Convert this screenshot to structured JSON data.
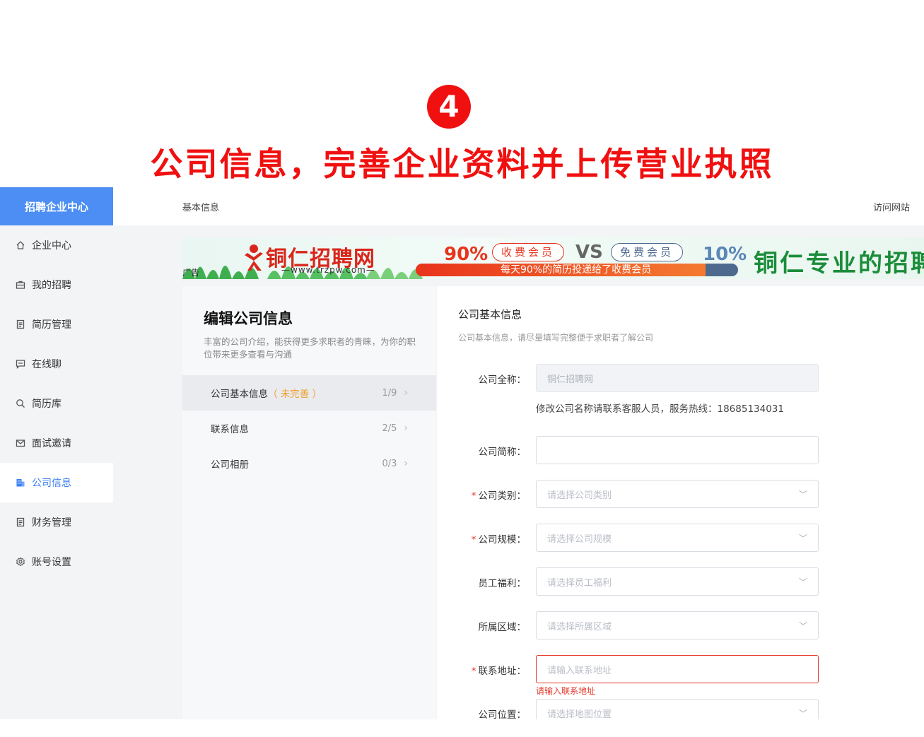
{
  "banner": {
    "step_number": "4",
    "headline": "公司信息，完善企业资料并上传营业执照"
  },
  "sidebar": {
    "brand": "招聘企业中心",
    "items": [
      {
        "label": "企业中心",
        "icon": "home-icon"
      },
      {
        "label": "我的招聘",
        "icon": "briefcase-icon"
      },
      {
        "label": "简历管理",
        "icon": "document-icon"
      },
      {
        "label": "在线聊",
        "icon": "chat-icon"
      },
      {
        "label": "简历库",
        "icon": "search-icon"
      },
      {
        "label": "面试邀请",
        "icon": "mail-icon"
      },
      {
        "label": "公司信息",
        "icon": "building-icon"
      },
      {
        "label": "财务管理",
        "icon": "document-icon"
      },
      {
        "label": "账号设置",
        "icon": "gear-icon"
      }
    ],
    "active_label": "公司信息"
  },
  "topbar": {
    "breadcrumb": "基本信息",
    "visit_site": "访问网站"
  },
  "ad": {
    "tag": "广告",
    "logo": "铜仁招聘网",
    "url": "—www.trzpw.com—",
    "paid_pct": "90%",
    "paid_label": "收费会员",
    "vs": "VS",
    "free_label": "免费会员",
    "free_pct": "10%",
    "bar_text": "每天90%的简历投递给了收费会员",
    "slogan": "铜仁专业的招聘"
  },
  "left_panel": {
    "title": "编辑公司信息",
    "desc": "丰富的公司介绍，能获得更多求职者的青睐，为你的职位带来更多查看与沟通",
    "sections": [
      {
        "label": "公司基本信息",
        "status": "（ 未完善 ）",
        "count": "1/9"
      },
      {
        "label": "联系信息",
        "status": "",
        "count": "2/5"
      },
      {
        "label": "公司相册",
        "status": "",
        "count": "0/3"
      }
    ]
  },
  "form": {
    "title": "公司基本信息",
    "desc": "公司基本信息，请尽量填写完整便于求职者了解公司",
    "full_name": {
      "label": "公司全称：",
      "value": "铜仁招聘网"
    },
    "name_hint": "修改公司名称请联系客服人员，服务热线：18685134031",
    "short_name": {
      "label": "公司简称：",
      "value": ""
    },
    "category": {
      "label": "公司类别：",
      "placeholder": "请选择公司类别"
    },
    "scale": {
      "label": "公司规模：",
      "placeholder": "请选择公司规模"
    },
    "welfare": {
      "label": "员工福利：",
      "placeholder": "请选择员工福利"
    },
    "region": {
      "label": "所属区域：",
      "placeholder": "请选择所属区域"
    },
    "address": {
      "label": "联系地址：",
      "placeholder": "请输入联系地址",
      "error": "请输入联系地址"
    },
    "location": {
      "label": "公司位置：",
      "placeholder": "请选择地图位置"
    },
    "required_mark": "*"
  },
  "colors": {
    "accent": "#3b7ff5",
    "brand_bg": "#4c8ef3",
    "headline": "#f01010",
    "error": "#e5382b",
    "warning": "#f0a030"
  }
}
